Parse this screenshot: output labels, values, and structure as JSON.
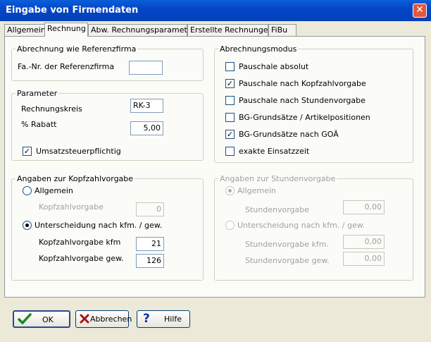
{
  "window": {
    "title": "Eingabe von Firmendaten",
    "close_glyph": "✕"
  },
  "tabs": [
    {
      "label": "Allgemein"
    },
    {
      "label": "Rechnung"
    },
    {
      "label": "Abw. Rechnungsparameter"
    },
    {
      "label": "Erstellte Rechnungen"
    },
    {
      "label": "FiBu"
    }
  ],
  "referenz": {
    "group_title": "Abrechnung wie Referenzfirma",
    "label": "Fa.-Nr. der Referenzfirma",
    "value": ""
  },
  "parameter": {
    "group_title": "Parameter",
    "rechnungskreis_label": "Rechnungskreis",
    "rechnungskreis_value": "RK-3",
    "rabatt_label": "% Rabatt",
    "rabatt_value": "5,00",
    "ust_label": "Umsatzsteuerpflichtig",
    "ust_checked": true
  },
  "modus": {
    "group_title": "Abrechnungsmodus",
    "items": [
      {
        "label": "Pauschale absolut",
        "checked": false
      },
      {
        "label": "Pauschale nach Kopfzahlvorgabe",
        "checked": true
      },
      {
        "label": "Pauschale nach Stundenvorgabe",
        "checked": false
      },
      {
        "label": "BG-Grundsätze / Artikelpositionen",
        "checked": false
      },
      {
        "label": "BG-Grundsätze nach GOÄ",
        "checked": true
      },
      {
        "label": "exakte Einsatzzeit",
        "checked": false
      }
    ]
  },
  "kopf": {
    "group_title": "Angaben zur Kopfzahlvorgabe",
    "allgemein_label": "Allgemein",
    "kopfzahl_label": "Kopfzahlvorgabe",
    "kopfzahl_value": "0",
    "unterscheidung_label": "Unterscheidung nach kfm. / gew.",
    "kfm_label": "Kopfzahlvorgabe kfm",
    "kfm_value": "21",
    "gew_label": "Kopfzahlvorgabe gew.",
    "gew_value": "126",
    "selected": "unterscheidung"
  },
  "stunden": {
    "group_title": "Angaben zur Stundenvorgabe",
    "allgemein_label": "Allgemein",
    "stunden_label": "Stundenvorgabe",
    "stunden_value": "0,00",
    "unterscheidung_label": "Unterscheidung nach kfm. / gew.",
    "kfm_label": "Stundenvorgabe kfm.",
    "kfm_value": "0,00",
    "gew_label": "Stundenvorgabe gew.",
    "gew_value": "0,00",
    "selected": "allgemein"
  },
  "buttons": {
    "ok": "OK",
    "abbrechen": "Abbrechen",
    "hilfe": "Hilfe"
  },
  "colors": {
    "check_icon": "#1a8a1a",
    "cancel_icon": "#b01010",
    "help_icon": "#1030b0"
  },
  "icons": {
    "ok": "checkmark-icon",
    "abbrechen": "x-icon",
    "hilfe": "question-icon"
  }
}
